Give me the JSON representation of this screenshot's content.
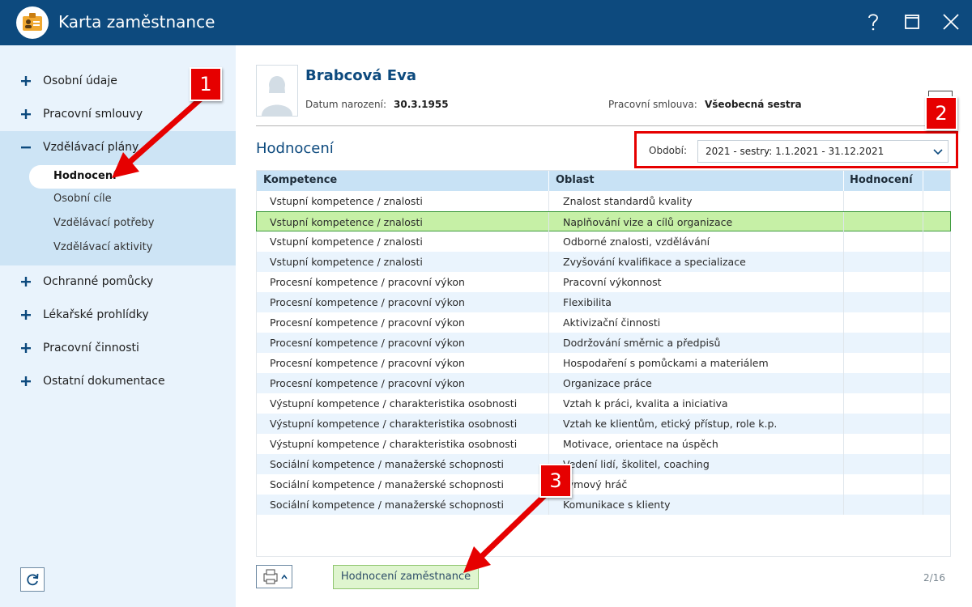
{
  "window": {
    "title": "Karta zaměstnance",
    "controls": [
      "help-icon",
      "maximize-icon",
      "close-icon"
    ],
    "colors": {
      "titlebar": "#0d4a7e",
      "sidebar": "#e9f3fc",
      "accent": "#0d4a7e",
      "selected_row": "#c6f0a6",
      "annotation": "#e60000"
    }
  },
  "sidebar": {
    "items": [
      {
        "label": "Osobní údaje",
        "icon": "plus-icon"
      },
      {
        "label": "Pracovní smlouvy",
        "icon": "plus-icon"
      },
      {
        "label": "Vzdělávací plány",
        "icon": "minus-icon",
        "expanded": true,
        "children": [
          "Hodnocení",
          "Osobní cíle",
          "Vzdělávací potřeby",
          "Vzdělávací aktivity"
        ],
        "active_child": "Hodnocení"
      },
      {
        "label": "Ochranné pomůcky",
        "icon": "plus-icon"
      },
      {
        "label": "Lékařské prohlídky",
        "icon": "plus-icon"
      },
      {
        "label": "Pracovní činnosti",
        "icon": "plus-icon"
      },
      {
        "label": "Ostatní dokumentace",
        "icon": "plus-icon"
      }
    ],
    "refresh_icon": "refresh-icon"
  },
  "employee": {
    "name": "Brabcová Eva",
    "dob_label": "Datum narození:",
    "dob": "30.3.1955",
    "contract_label": "Pracovní smlouva:",
    "contract": "Všeobecná sestra"
  },
  "section": {
    "title": "Hodnocení",
    "period_label": "Období:",
    "period_value": "2021 - sestry: 1.1.2021 - 31.12.2021"
  },
  "table": {
    "columns": [
      "Kompetence",
      "Oblast",
      "Hodnocení"
    ],
    "rows": [
      {
        "competence": "Vstupní kompetence / znalosti",
        "area": "Znalost standardů kvality",
        "rating": ""
      },
      {
        "competence": "Vstupní kompetence / znalosti",
        "area": "Naplňování vize a cílů organizace",
        "rating": ""
      },
      {
        "competence": "Vstupní kompetence / znalosti",
        "area": "Odborné znalosti, vzdělávání",
        "rating": ""
      },
      {
        "competence": "Vstupní kompetence / znalosti",
        "area": "Zvyšování kvalifikace a specializace",
        "rating": ""
      },
      {
        "competence": "Procesní kompetence / pracovní výkon",
        "area": "Pracovní výkonnost",
        "rating": ""
      },
      {
        "competence": "Procesní kompetence / pracovní výkon",
        "area": "Flexibilita",
        "rating": ""
      },
      {
        "competence": "Procesní kompetence / pracovní výkon",
        "area": "Aktivizační činnosti",
        "rating": ""
      },
      {
        "competence": "Procesní kompetence / pracovní výkon",
        "area": "Dodržování směrnic a předpisů",
        "rating": ""
      },
      {
        "competence": "Procesní kompetence / pracovní výkon",
        "area": "Hospodaření s pomůckami a materiálem",
        "rating": ""
      },
      {
        "competence": "Procesní kompetence / pracovní výkon",
        "area": "Organizace práce",
        "rating": ""
      },
      {
        "competence": "Výstupní kompetence / charakteristika osobnosti",
        "area": "Vztah k práci, kvalita a iniciativa",
        "rating": ""
      },
      {
        "competence": "Výstupní kompetence / charakteristika osobnosti",
        "area": "Vztah ke klientům, etický přístup, role k.p.",
        "rating": ""
      },
      {
        "competence": "Výstupní kompetence / charakteristika osobnosti",
        "area": "Motivace, orientace na úspěch",
        "rating": ""
      },
      {
        "competence": "Sociální kompetence / manažerské schopnosti",
        "area": "Vedení lidí, školitel, coaching",
        "rating": ""
      },
      {
        "competence": "Sociální kompetence / manažerské schopnosti",
        "area": "Týmový hráč",
        "rating": ""
      },
      {
        "competence": "Sociální kompetence / manažerské schopnosti",
        "area": "Komunikace s klienty",
        "rating": ""
      }
    ],
    "selected_row": 2
  },
  "footer": {
    "print_icon": "printer-icon",
    "evaluate_button": "Hodnocení zaměstnance",
    "page_count": "2/16"
  },
  "annotations": {
    "badge1": "1",
    "badge2": "2",
    "badge3": "3"
  }
}
